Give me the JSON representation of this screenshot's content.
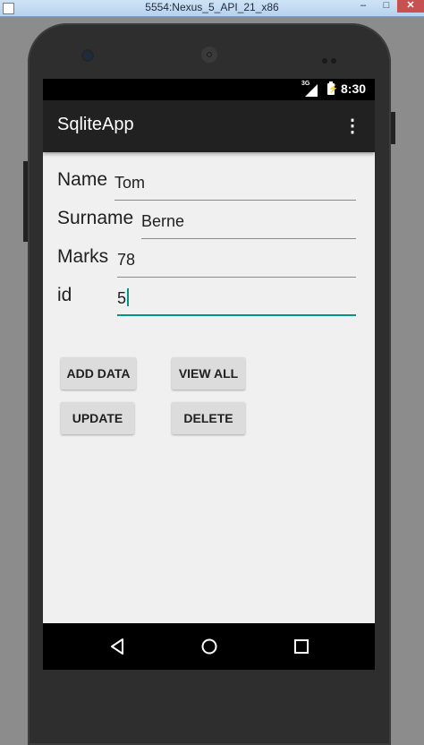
{
  "window": {
    "title": "5554:Nexus_5_API_21_x86",
    "minimize_glyph": "–",
    "maximize_glyph": "□",
    "close_glyph": "✕"
  },
  "statusbar": {
    "network": "3G",
    "time": "8:30",
    "icons": [
      "signal-icon",
      "battery-icon"
    ]
  },
  "appbar": {
    "title": "SqliteApp",
    "overflow_glyph": "⋮"
  },
  "form": {
    "name_label": "Name",
    "name_value": "Tom",
    "surname_label": "Surname",
    "surname_value": "Berne",
    "marks_label": "Marks",
    "marks_value": "78",
    "id_label": "id",
    "id_value": "5"
  },
  "buttons": {
    "add": "ADD DATA",
    "view_all": "VIEW ALL",
    "update": "UPDATE",
    "delete": "DELETE"
  },
  "navbar": {
    "icons": [
      "back-icon",
      "home-icon",
      "recents-icon"
    ]
  },
  "colors": {
    "accent": "#009688",
    "appbar": "#212121",
    "background": "#f0f0f0"
  }
}
